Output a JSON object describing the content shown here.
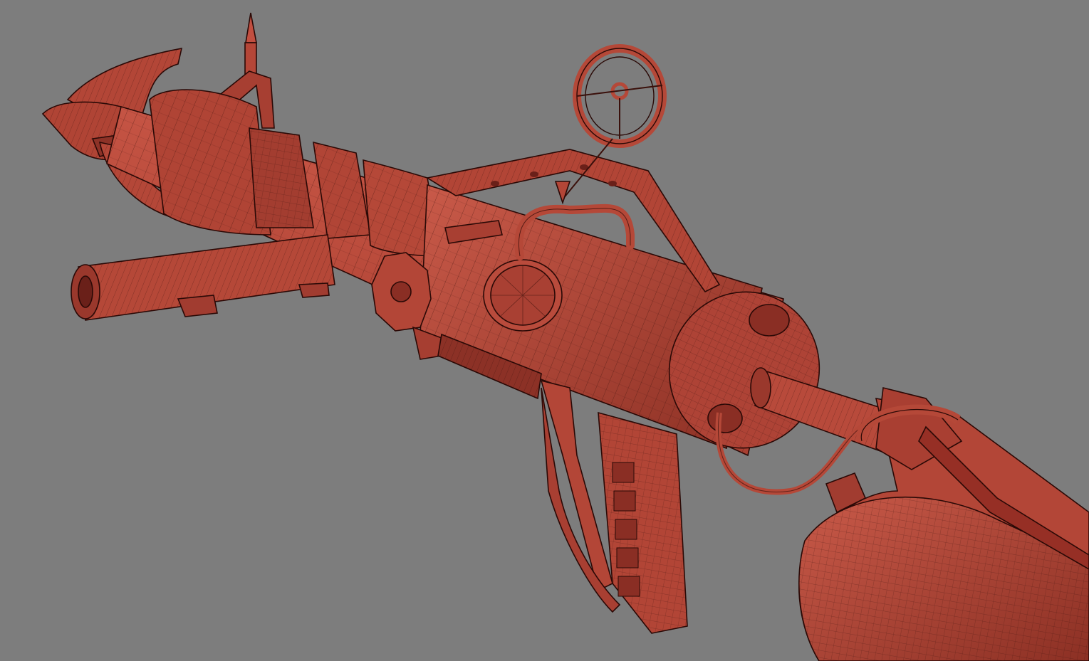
{
  "viewport": {
    "background_color": "#7d7d7d",
    "model_color": "#b8493b",
    "model_shadow_color": "#8a2f25",
    "wire_color": "#3a100b"
  }
}
